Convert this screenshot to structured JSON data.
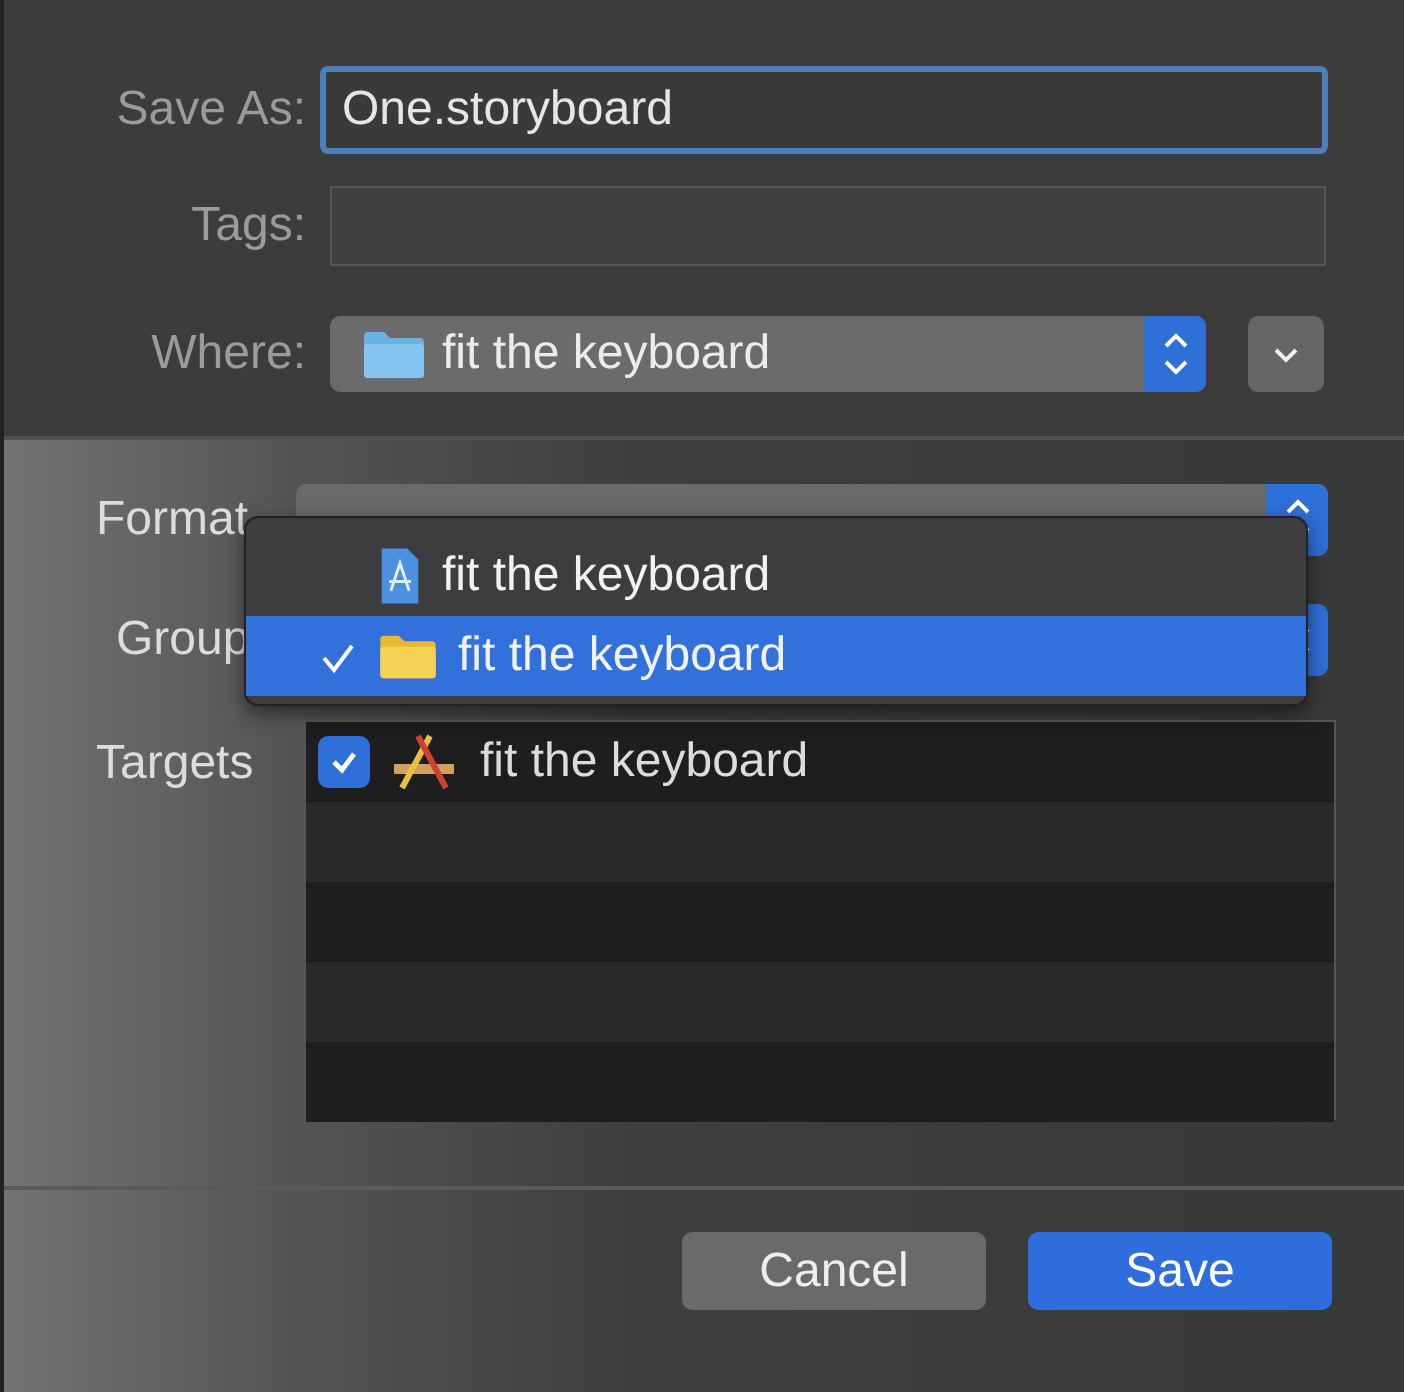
{
  "save_as": {
    "label": "Save As:",
    "value": "One.storyboard"
  },
  "tags": {
    "label": "Tags:"
  },
  "where": {
    "label": "Where:",
    "value": "fit the keyboard"
  },
  "format": {
    "label": "Format"
  },
  "group": {
    "label": "Group"
  },
  "group_menu": [
    {
      "label": "fit the keyboard",
      "kind": "project",
      "selected": false
    },
    {
      "label": "fit the keyboard",
      "kind": "folder",
      "selected": true
    }
  ],
  "targets": {
    "label": "Targets",
    "rows": [
      {
        "label": "fit the keyboard",
        "checked": true
      }
    ]
  },
  "buttons": [
    {
      "label": "Cancel",
      "kind": "secondary"
    },
    {
      "label": "Save",
      "kind": "primary"
    }
  ]
}
